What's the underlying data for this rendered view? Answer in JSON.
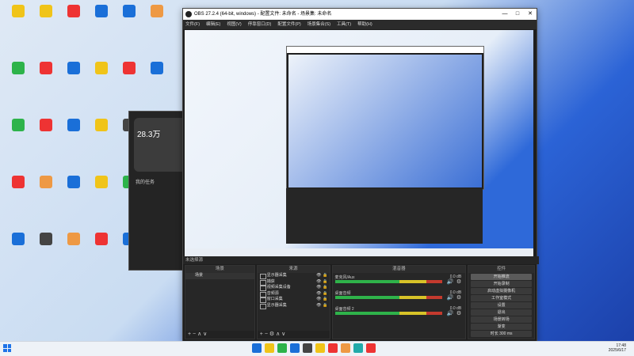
{
  "desktop": {
    "icon_colors": [
      "#f0c419",
      "#f0c419",
      "#e33",
      "#1a6fd8",
      "#1a6fd8",
      "#e94",
      "#2db34a",
      "#e33",
      "#1a6fd8",
      "#f0c419",
      "#e33",
      "#1a6fd8",
      "#2db34a",
      "#e33",
      "#1a6fd8",
      "#f0c419",
      "#444",
      "#2aa",
      "#e33",
      "#e94",
      "#1a6fd8",
      "#f0c419",
      "#2db34a",
      "#e33",
      "#1a6fd8",
      "#444",
      "#e94",
      "#e33",
      "#1a6fd8",
      "#2db34a"
    ],
    "widget": {
      "value": "28.3万",
      "tasks": "我的任务"
    }
  },
  "obs": {
    "title": "OBS 27.2.4 (64-bit, windows) - 配置文件: 未命名 - 场景集: 未命名",
    "menu": [
      "文件(F)",
      "编辑(E)",
      "视图(V)",
      "停靠窗口(D)",
      "配置文件(P)",
      "场景集合(S)",
      "工具(T)",
      "帮助(H)"
    ],
    "dock_row_label": "未选择源",
    "docks": {
      "scenes": {
        "title": "场景",
        "items": [
          "场景"
        ]
      },
      "sources": {
        "title": "来源",
        "items": [
          "显示器采集",
          "捕获",
          "视频采集设备",
          "音频源",
          "窗口采集",
          "显示器采集"
        ]
      },
      "mixer": {
        "title": "混音器",
        "channels": [
          {
            "name": "麦克风/Aux",
            "db": "0.0 dB"
          },
          {
            "name": "桌面音频",
            "db": "0.0 dB"
          },
          {
            "name": "桌面音频 2",
            "db": "0.0 dB"
          }
        ]
      },
      "transitions": {
        "title": "转场特效",
        "type": "渐变",
        "duration_label": "时长",
        "duration": "300 ms"
      },
      "controls": {
        "title": "控件",
        "buttons": [
          "开始推流",
          "开始录制",
          "启动虚拟摄像机",
          "工作室模式",
          "设置",
          "退出"
        ],
        "foot_label": "场景转场"
      }
    }
  },
  "taskbar": {
    "time": "17:48",
    "date": "2025/6/17",
    "app_colors": [
      "#1a6fd8",
      "#f0c419",
      "#2db34a",
      "#1a6fd8",
      "#444",
      "#f0c419",
      "#e33",
      "#e94",
      "#2aa",
      "#e33"
    ]
  }
}
